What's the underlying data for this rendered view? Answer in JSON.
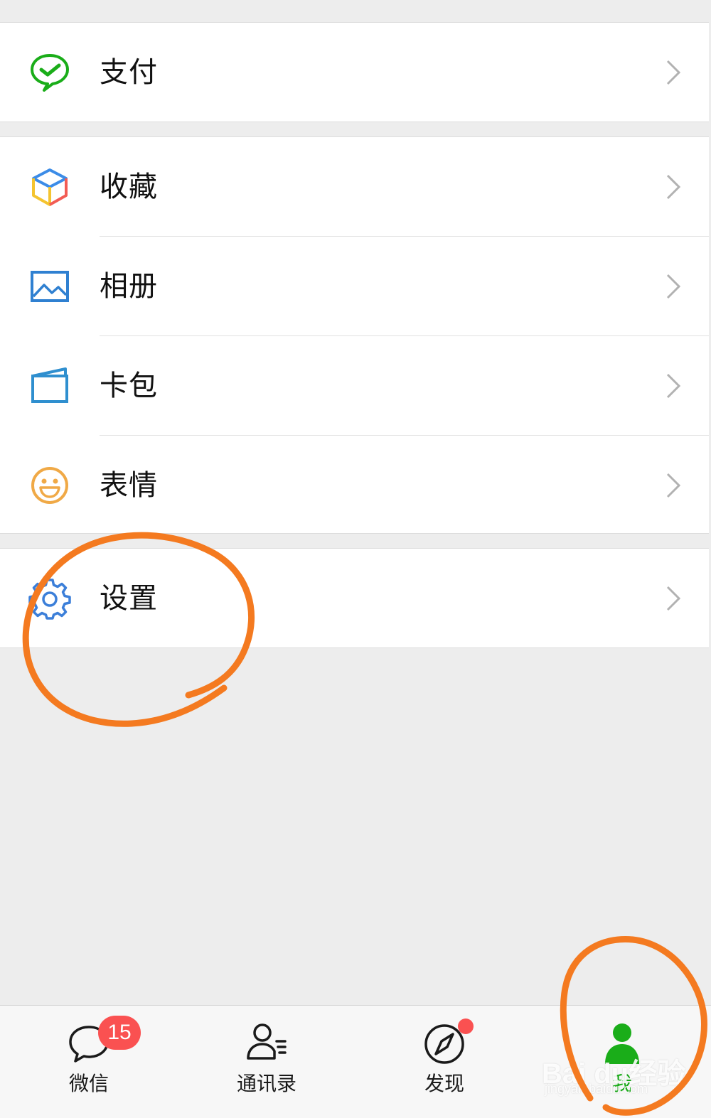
{
  "menu": {
    "pay": {
      "label": "支付",
      "icon": "wechat-pay-icon"
    },
    "favorites": {
      "label": "收藏",
      "icon": "favorites-cube-icon"
    },
    "album": {
      "label": "相册",
      "icon": "album-picture-icon"
    },
    "cards": {
      "label": "卡包",
      "icon": "card-wallet-icon"
    },
    "stickers": {
      "label": "表情",
      "icon": "smiley-face-icon"
    },
    "settings": {
      "label": "设置",
      "icon": "gear-icon"
    },
    "chevron_icon": "chevron-right-icon"
  },
  "tabbar": {
    "chats": {
      "label": "微信",
      "badge": "15",
      "icon": "chat-bubble-icon"
    },
    "contacts": {
      "label": "通讯录",
      "icon": "contacts-icon"
    },
    "discover": {
      "label": "发现",
      "icon": "compass-icon"
    },
    "me": {
      "label": "我",
      "icon": "person-icon"
    }
  },
  "watermark": {
    "brand": "Bai du经验",
    "url": "jingyan.baidu.com"
  },
  "colors": {
    "accent_green": "#1aad19",
    "badge_red": "#fa5151",
    "annotation_orange": "#f47a20",
    "background": "#ededed",
    "tabbar_background": "#f7f7f7"
  }
}
